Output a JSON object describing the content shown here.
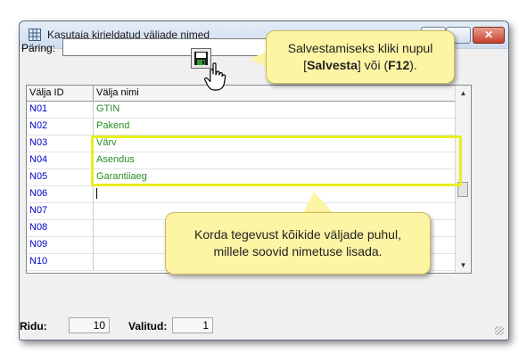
{
  "window": {
    "title": "Kasutaja kirjeldatud väljade nimed"
  },
  "query": {
    "label": "Päring:",
    "value": ""
  },
  "grid": {
    "headers": {
      "id": "Välja ID",
      "name": "Välja nimi"
    },
    "rows": [
      {
        "id": "N01",
        "name": "GTIN"
      },
      {
        "id": "N02",
        "name": "Pakend"
      },
      {
        "id": "N03",
        "name": "Värv"
      },
      {
        "id": "N04",
        "name": "Asendus"
      },
      {
        "id": "N05",
        "name": "Garantiiaeg"
      },
      {
        "id": "N06",
        "name": ""
      },
      {
        "id": "N07",
        "name": ""
      },
      {
        "id": "N08",
        "name": ""
      },
      {
        "id": "N09",
        "name": ""
      },
      {
        "id": "N10",
        "name": ""
      }
    ]
  },
  "callouts": {
    "top": {
      "line1": "Salvestamiseks kliki nupul",
      "bracket_open": "[",
      "save_word": "Salvesta",
      "middle": "] või (",
      "key": "F12",
      "close": ")."
    },
    "bottom": {
      "line1": "Korda tegevust kõikide väljade puhul,",
      "line2": "millele soovid nimetuse lisada."
    }
  },
  "status": {
    "rows_label": "Ridu:",
    "rows_value": "10",
    "selected_label": "Valitud:",
    "selected_value": "1"
  },
  "colors": {
    "id_text": "#0000cc",
    "name_text": "#2a8a2a",
    "highlight": "#e7ef1e",
    "callout_bg": "#fdf4a4"
  },
  "icons": {
    "app": "grid-app-icon",
    "save": "floppy-save-icon",
    "pointer": "hand-pointer-icon",
    "close": "close-icon"
  }
}
